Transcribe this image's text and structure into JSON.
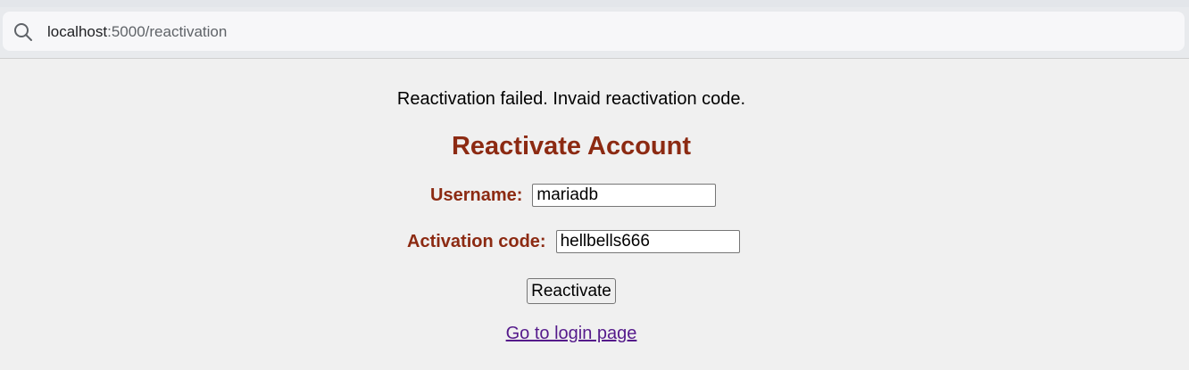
{
  "browser": {
    "url_host": "localhost",
    "url_path": ":5000/reactivation"
  },
  "page": {
    "message": "Reactivation failed. Invaid reactivation code.",
    "title": "Reactivate Account",
    "username_label": "Username:",
    "username_value": "mariadb",
    "code_label": "Activation code:",
    "code_value": "hellbells666",
    "submit_label": "Reactivate",
    "login_link_text": "Go to login page"
  },
  "colors": {
    "heading": "#8c2a12",
    "link": "#551a8b"
  }
}
